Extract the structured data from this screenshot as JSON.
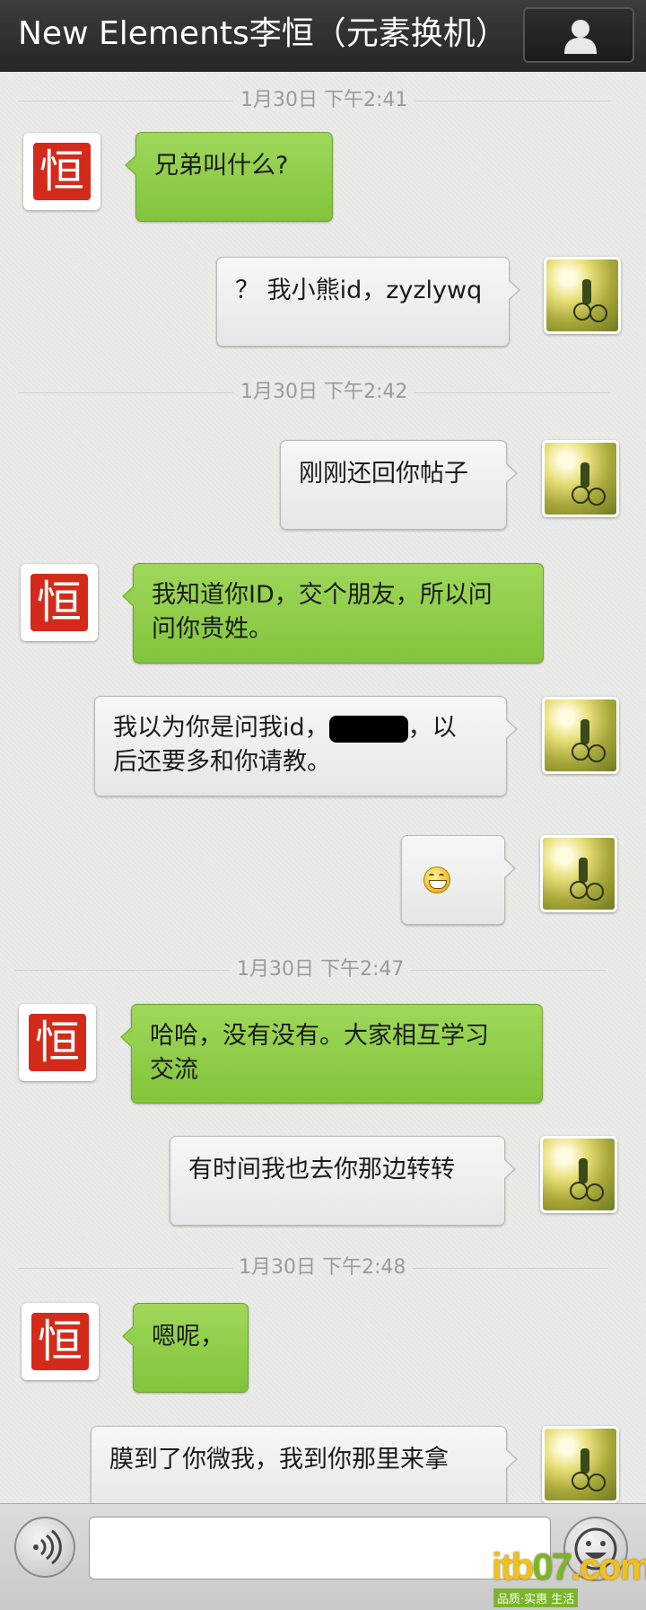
{
  "header": {
    "title": "New Elements李恒（元素换机）",
    "profile_icon": "person-icon"
  },
  "timestamps": [
    "1月30日 下午2:41",
    "1月30日 下午2:42",
    "1月30日 下午2:47",
    "1月30日 下午2:48"
  ],
  "contact_avatar": {
    "seal_char": "恒",
    "color": "#d42a1a"
  },
  "messages": [
    {
      "from": "contact",
      "text": "兄弟叫什么?"
    },
    {
      "from": "me",
      "text": "？ 我小熊id，zyzlywq"
    },
    {
      "from": "me",
      "text": "刚刚还回你帖子"
    },
    {
      "from": "contact",
      "line1": "我知道你ID，交个朋友，所以问",
      "line2": "问你贵姓。"
    },
    {
      "from": "me",
      "line1_pre": "我以为你是问我id，",
      "line1_post": "，以",
      "line2": "后还要多和你请教。"
    },
    {
      "from": "me",
      "emoji": "grinning-emoji"
    },
    {
      "from": "contact",
      "line1": "哈哈，没有没有。大家相互学习",
      "line2": "交流"
    },
    {
      "from": "me",
      "text": "有时间我也去你那边转转"
    },
    {
      "from": "contact",
      "text": "嗯呢，"
    },
    {
      "from": "me",
      "text": "膜到了你微我，我到你那里来拿"
    }
  ],
  "input": {
    "voice_icon": "voice-icon",
    "emoji_icon": "emoji-face-icon",
    "value": ""
  },
  "watermark": {
    "logo_pre": "itb",
    "logo_mid": "07",
    "logo_post": ".com",
    "tagline": "品质·实惠    生活"
  },
  "colors": {
    "green_bubble": "#8ccb45",
    "gray_bubble": "#eeeeee",
    "header": "#2e2e2e"
  }
}
